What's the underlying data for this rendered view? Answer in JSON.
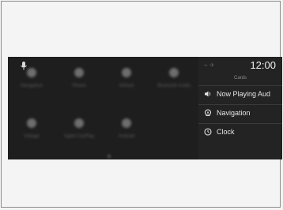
{
  "status": {
    "time": "12:00",
    "status_icons": "⌁ ✈"
  },
  "cards": {
    "title": "Cards",
    "items": [
      {
        "label": "Now Playing Aud",
        "icon": "speaker-icon"
      },
      {
        "label": "Navigation",
        "icon": "navigation-icon"
      },
      {
        "label": "Clock",
        "icon": "clock-icon"
      }
    ]
  },
  "home": {
    "apps": [
      {
        "label": "Navigation"
      },
      {
        "label": "Phone"
      },
      {
        "label": "Vehicle"
      },
      {
        "label": "Bluetooth Audio"
      },
      {
        "label": "Voltage"
      },
      {
        "label": "Apple CarPlay"
      },
      {
        "label": "Android"
      }
    ]
  }
}
